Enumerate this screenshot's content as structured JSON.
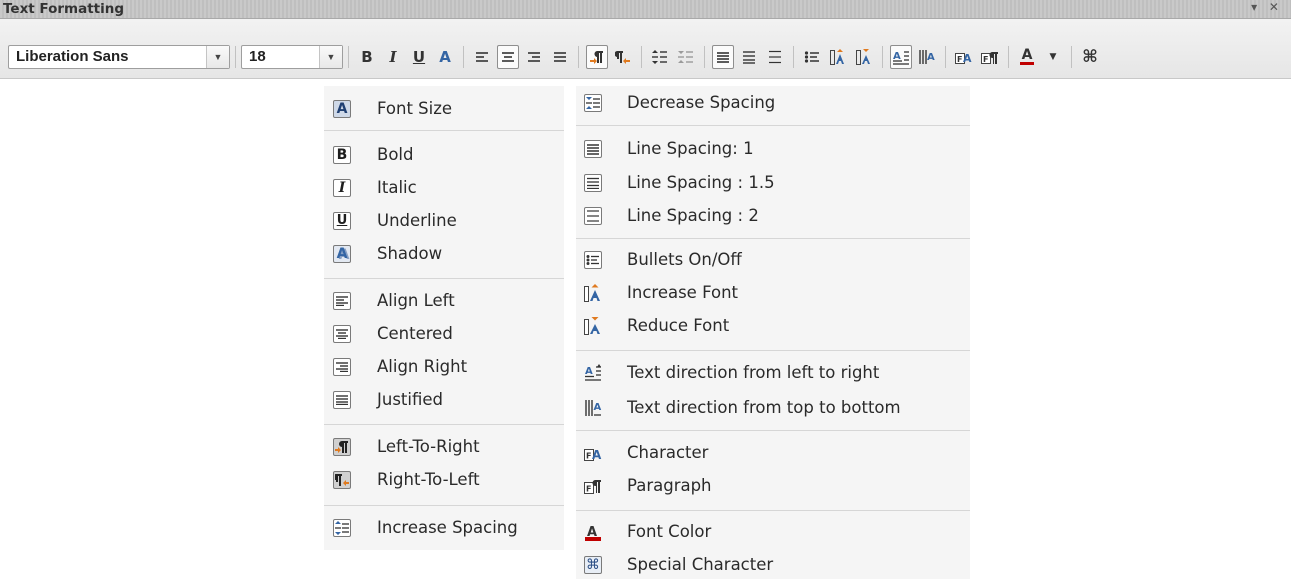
{
  "toolbar": {
    "title": "Text Formatting",
    "window_controls": "▾ ✕",
    "font_name": "Liberation Sans",
    "font_size": "18"
  },
  "menu_left": {
    "items": [
      {
        "label": "Font Size",
        "icon": "font-size-icon"
      },
      {
        "label": "Bold",
        "icon": "bold-icon"
      },
      {
        "label": "Italic",
        "icon": "italic-icon"
      },
      {
        "label": "Underline",
        "icon": "underline-icon"
      },
      {
        "label": "Shadow",
        "icon": "shadow-icon"
      },
      {
        "label": "Align Left",
        "icon": "align-left-icon"
      },
      {
        "label": "Centered",
        "icon": "align-center-icon"
      },
      {
        "label": "Align Right",
        "icon": "align-right-icon"
      },
      {
        "label": "Justified",
        "icon": "justify-icon"
      },
      {
        "label": "Left-To-Right",
        "icon": "left-to-right-icon"
      },
      {
        "label": "Right-To-Left",
        "icon": "right-to-left-icon"
      },
      {
        "label": "Increase Spacing",
        "icon": "increase-spacing-icon"
      }
    ]
  },
  "menu_right": {
    "items": [
      {
        "label": "Decrease Spacing",
        "icon": "decrease-spacing-icon"
      },
      {
        "label": "Line Spacing: 1",
        "icon": "line-spacing-1-icon"
      },
      {
        "label": "Line Spacing : 1.5",
        "icon": "line-spacing-15-icon"
      },
      {
        "label": "Line Spacing : 2",
        "icon": "line-spacing-2-icon"
      },
      {
        "label": "Bullets On/Off",
        "icon": "bullets-icon"
      },
      {
        "label": "Increase Font",
        "icon": "increase-font-icon"
      },
      {
        "label": "Reduce Font",
        "icon": "reduce-font-icon"
      },
      {
        "label": "Text direction from left to right",
        "icon": "text-direction-ltr-icon"
      },
      {
        "label": "Text direction from top to bottom",
        "icon": "text-direction-ttb-icon"
      },
      {
        "label": "Character",
        "icon": "character-icon"
      },
      {
        "label": "Paragraph",
        "icon": "paragraph-icon"
      },
      {
        "label": "Font Color",
        "icon": "font-color-icon"
      },
      {
        "label": "Special Character",
        "icon": "special-character-icon"
      }
    ]
  },
  "colors": {
    "icon_blue": "#3465a4",
    "icon_orange": "#e07a1f",
    "font_color_red": "#c00000"
  }
}
